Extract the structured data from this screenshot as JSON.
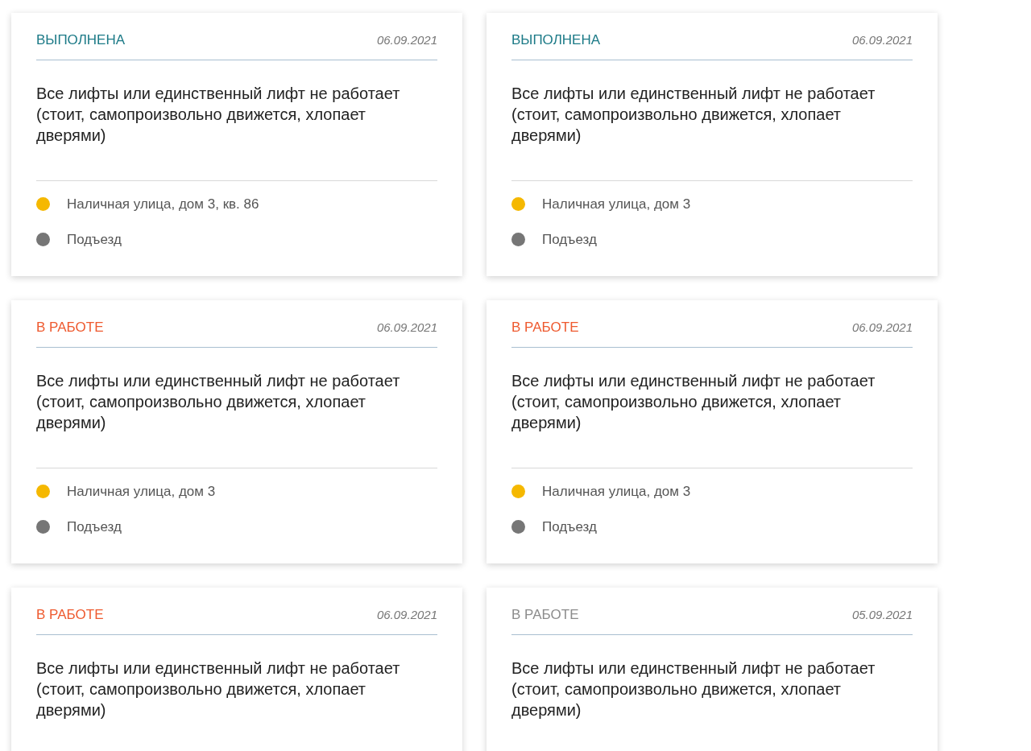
{
  "cards": [
    {
      "status": "ВЫПОЛНЕНА",
      "color": "#1c7a87",
      "date": "06.09.2021",
      "description": "Все лифты или единственный лифт не работает (стоит, самопроизвольно движется, хлопает дверями)",
      "items": [
        {
          "text": "Наличная улица, дом 3, кв. 86",
          "color": "#f5b800"
        },
        {
          "text": "Подъезд",
          "color": "#767676"
        }
      ]
    },
    {
      "status": "ВЫПОЛНЕНА",
      "color": "#1c7a87",
      "date": "06.09.2021",
      "description": "Все лифты или единственный лифт не работает (стоит, самопроизвольно движется, хлопает дверями)",
      "items": [
        {
          "text": "Наличная улица, дом 3",
          "color": "#f5b800"
        },
        {
          "text": "Подъезд",
          "color": "#767676"
        }
      ]
    },
    {
      "status": "В РАБОТЕ",
      "color": "#ee5a2f",
      "date": "06.09.2021",
      "description": "Все лифты или единственный лифт не работает (стоит, самопроизвольно движется, хлопает дверями)",
      "items": [
        {
          "text": "Наличная улица, дом 3",
          "color": "#f5b800"
        },
        {
          "text": "Подъезд",
          "color": "#767676"
        }
      ]
    },
    {
      "status": "В РАБОТЕ",
      "color": "#ee5a2f",
      "date": "06.09.2021",
      "description": "Все лифты или единственный лифт не работает (стоит, самопроизвольно движется, хлопает дверями)",
      "items": [
        {
          "text": "Наличная улица, дом 3",
          "color": "#f5b800"
        },
        {
          "text": "Подъезд",
          "color": "#767676"
        }
      ]
    },
    {
      "status": "В РАБОТЕ",
      "color": "#ee5a2f",
      "date": "06.09.2021",
      "description": "Все лифты или единственный лифт не работает (стоит, самопроизвольно движется, хлопает дверями)"
    },
    {
      "status": "В РАБОТЕ",
      "color": "#8c8c8c",
      "date": "05.09.2021",
      "description": "Все лифты или единственный лифт не работает (стоит, самопроизвольно движется, хлопает дверями)"
    }
  ]
}
